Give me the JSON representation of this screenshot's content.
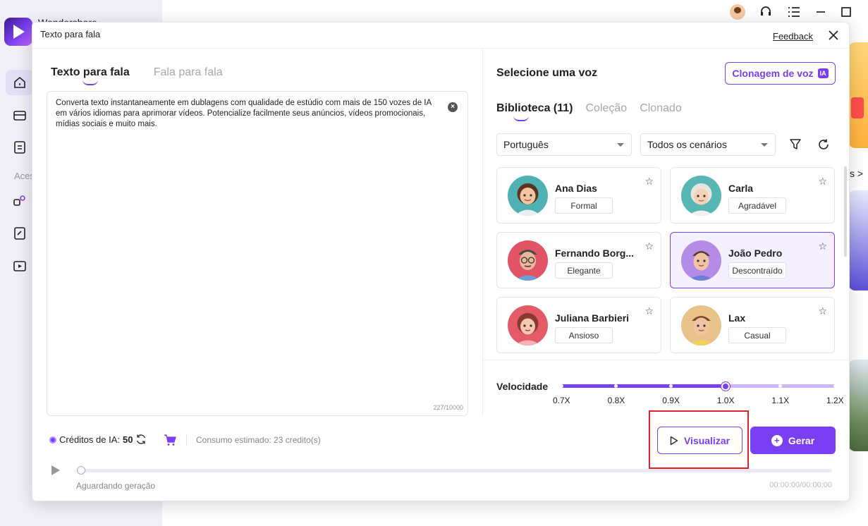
{
  "app": {
    "name": "Wondershare",
    "side_section_label": "Aces",
    "bg_link_arrow": "s >"
  },
  "dialog": {
    "title": "Texto para fala",
    "feedback": "Feedback"
  },
  "left": {
    "tabs": [
      {
        "label": "Texto para fala",
        "active": true
      },
      {
        "label": "Fala para fala",
        "active": false
      }
    ],
    "text": "Converta texto instantaneamente em dublagens com qualidade de estúdio com mais de 150 vozes de IA em vários idiomas para aprimorar vídeos. Potencialize facilmente seus anúncios, vídeos promocionais, mídias sociais e muito mais.",
    "char_count": "227/10000"
  },
  "right": {
    "title": "Selecione uma voz",
    "clone_button": "Clonagem de voz",
    "clone_badge": "IA",
    "tabs": [
      {
        "label": "Biblioteca (11)",
        "active": true
      },
      {
        "label": "Coleção",
        "active": false
      },
      {
        "label": "Clonado",
        "active": false
      }
    ],
    "language": "Português",
    "scenario": "Todos os cenários",
    "voices": [
      {
        "name": "Ana Dias",
        "tag": "Formal",
        "selected": false,
        "avatar": "woman-brown-hair"
      },
      {
        "name": "Carla",
        "tag": "Agradável",
        "selected": false,
        "avatar": "woman-white-hair"
      },
      {
        "name": "Fernando Borg...",
        "tag": "Elegante",
        "selected": false,
        "avatar": "man-glasses"
      },
      {
        "name": "João Pedro",
        "tag": "Descontraído",
        "selected": true,
        "avatar": "boy-purple"
      },
      {
        "name": "Juliana Barbieri",
        "tag": "Ansioso",
        "selected": false,
        "avatar": "woman-red"
      },
      {
        "name": "Lax",
        "tag": "Casual",
        "selected": false,
        "avatar": "boy-yellow"
      }
    ],
    "speed": {
      "label": "Velocidade",
      "ticks": [
        "0.7X",
        "0.8X",
        "0.9X",
        "1.0X",
        "1.1X",
        "1.2X"
      ],
      "value": "1.0X"
    }
  },
  "bottom": {
    "credits_label": "Créditos de IA:",
    "credits_value": "50",
    "consumo": "Consumo estimado: 23 credito(s)",
    "preview_button": "Visualizar",
    "generate_button": "Gerar",
    "status": "Aguardando geração",
    "time": "00:00:00/00:00:00"
  },
  "colors": {
    "accent": "#7b3ff2",
    "highlight": "#e0232b"
  }
}
